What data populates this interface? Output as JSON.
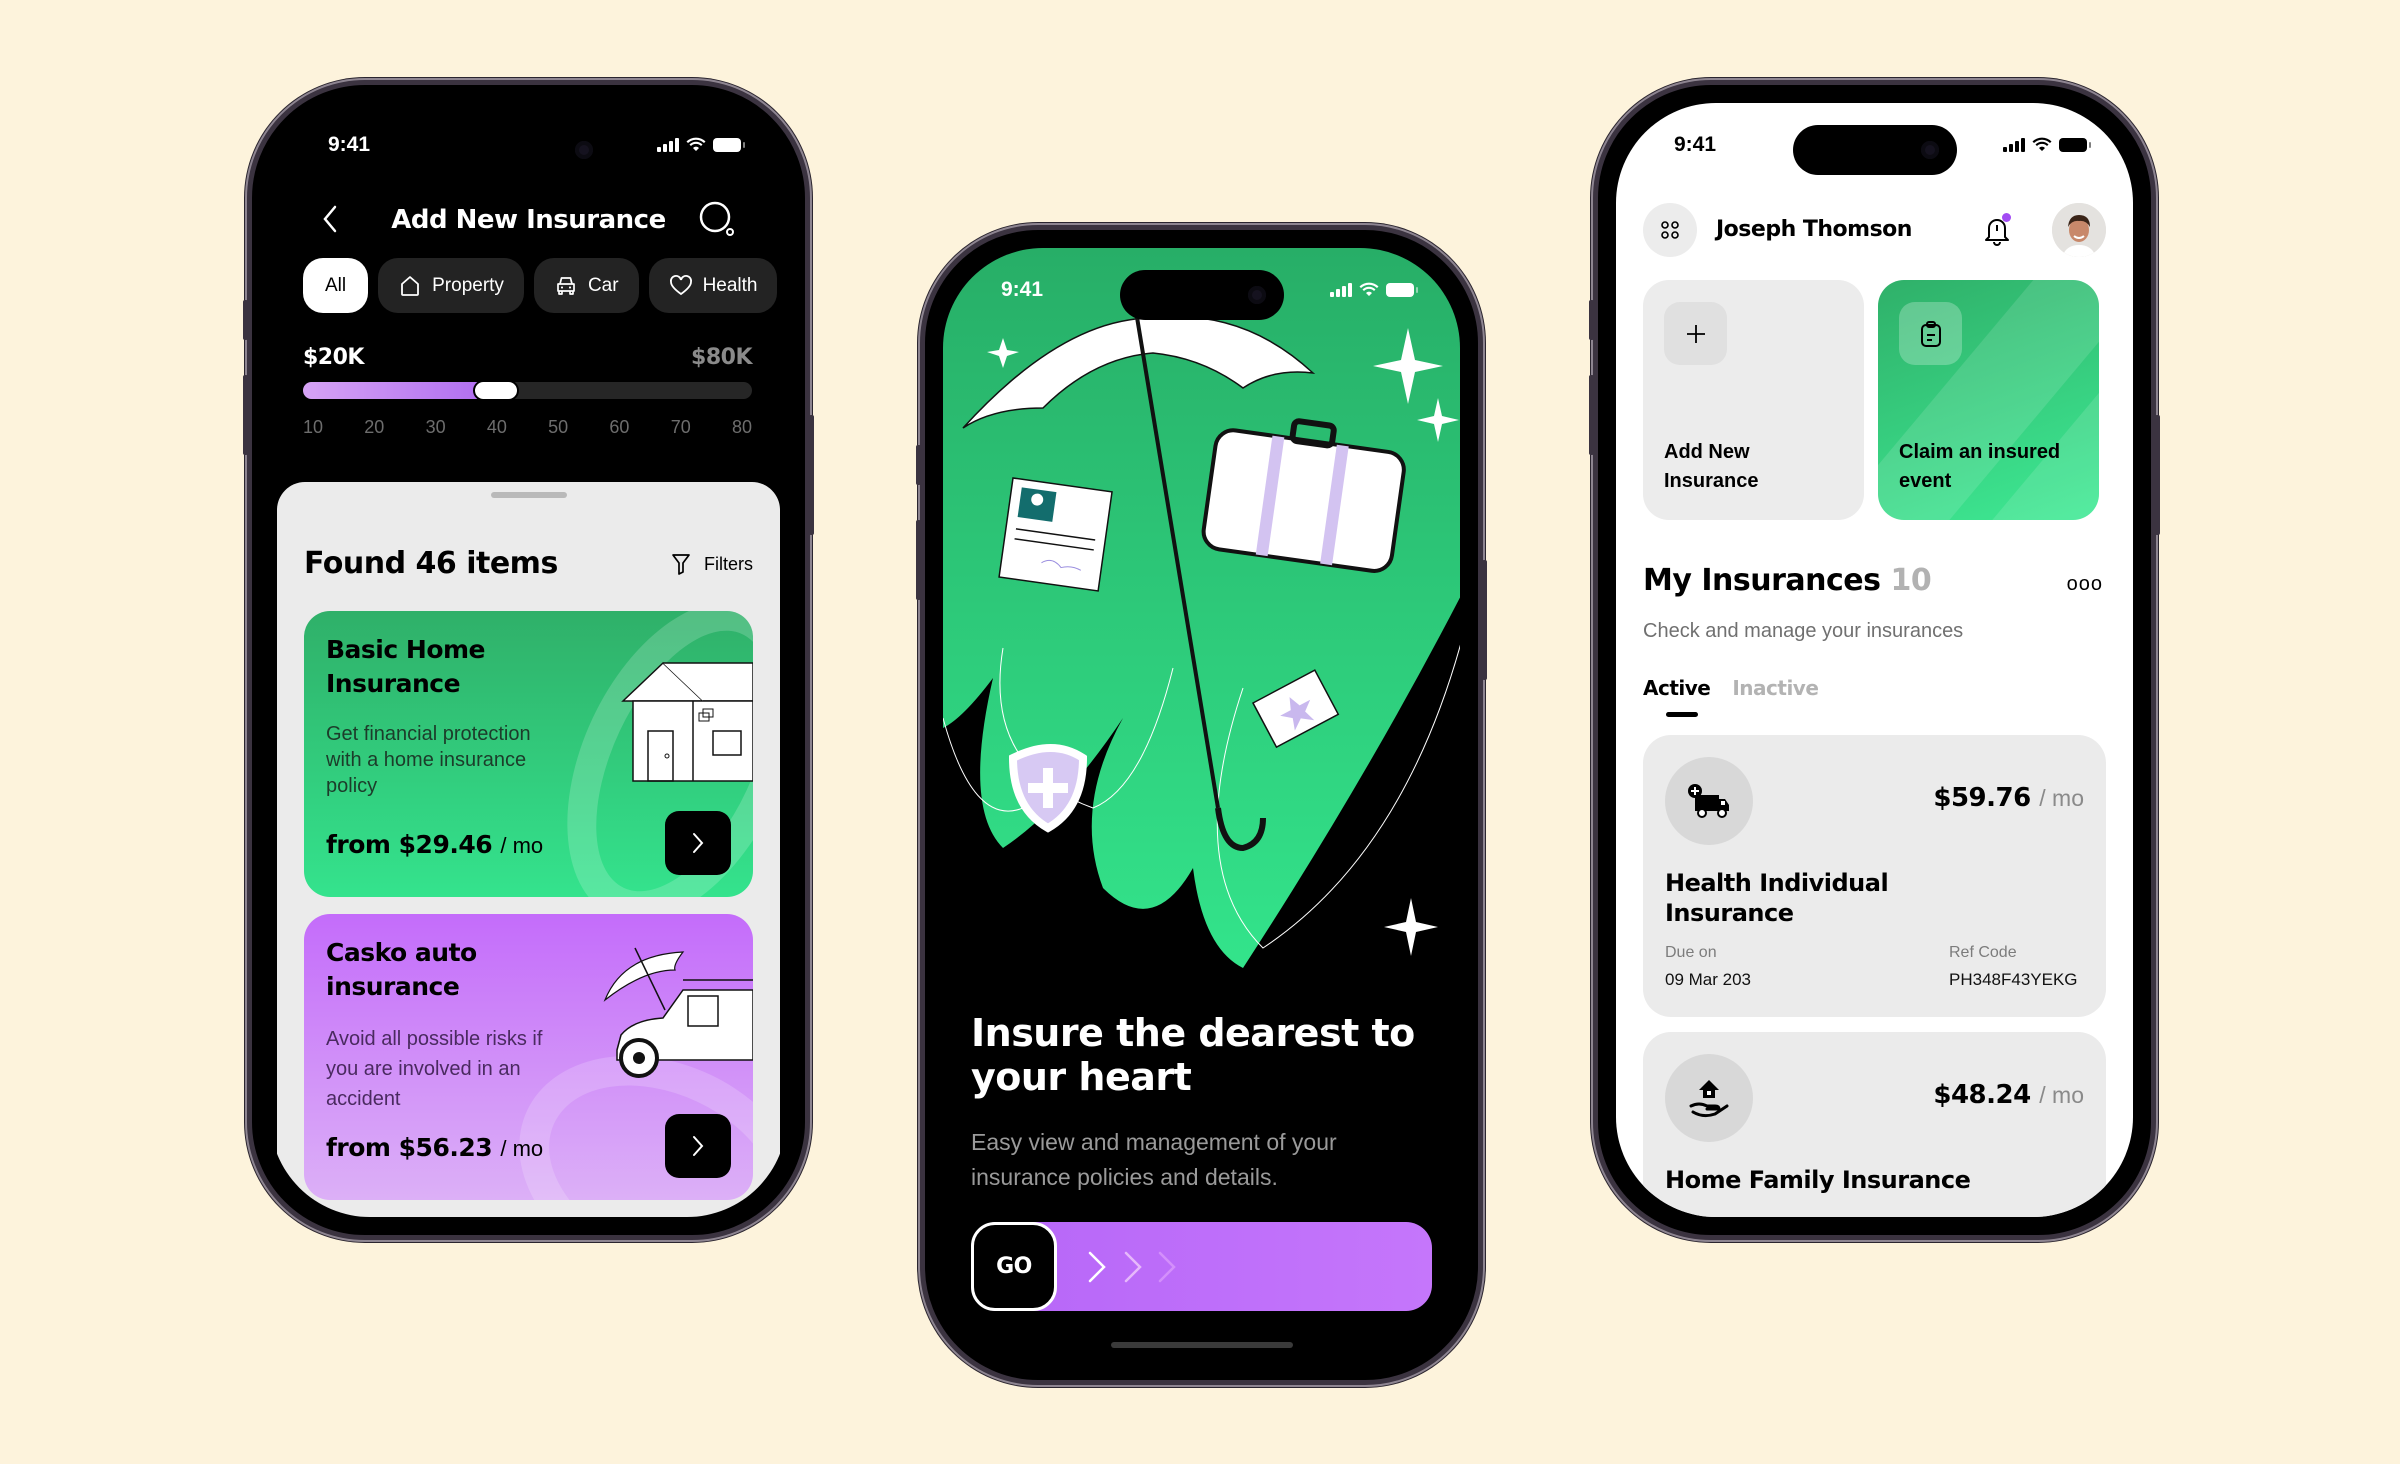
{
  "colors": {
    "background": "#fdf3dc",
    "green": "#2fd07e",
    "purple": "#b666f8",
    "notification_dot": "#a24bf3"
  },
  "phones": {
    "search": {
      "status": {
        "time": "9:41"
      },
      "header": {
        "title": "Add New Insurance",
        "back_icon": "chevron-left-icon",
        "search_icon": "search-icon"
      },
      "chips": [
        {
          "label": "All",
          "icon": null,
          "active": true
        },
        {
          "label": "Property",
          "icon": "house-icon",
          "active": false
        },
        {
          "label": "Car",
          "icon": "car-icon",
          "active": false
        },
        {
          "label": "Health",
          "icon": "heart-icon",
          "active": false
        }
      ],
      "range": {
        "min_label": "$20K",
        "max_label": "$80K",
        "ticks": [
          "10",
          "20",
          "30",
          "40",
          "50",
          "60",
          "70",
          "80"
        ],
        "axis_min": 10,
        "axis_max": 80,
        "selected_value": 37
      },
      "results": {
        "title": "Found 46 items",
        "filters_label": "Filters"
      },
      "cards": [
        {
          "title": "Basic Home Insurance",
          "description": "Get financial protection with a home insurance policy",
          "price_prefix": "from",
          "price": "$29.46",
          "period": "/ mo",
          "theme": "green"
        },
        {
          "title": "Casko auto insurance",
          "description": "Avoid all possible risks if you are involved in an accident",
          "price_prefix": "from",
          "price": "$56.23",
          "period": "/ mo",
          "theme": "purple"
        }
      ]
    },
    "onboarding": {
      "status": {
        "time": "9:41"
      },
      "headline": "Insure the dearest to your heart",
      "subtitle": "Easy view and management of your insurance policies and details.",
      "go_label": "GO"
    },
    "dashboard": {
      "status": {
        "time": "9:41"
      },
      "user_name": "Joseph Thomson",
      "has_notification": true,
      "quick_actions": [
        {
          "label": "Add New Insurance",
          "icon": "plus-icon"
        },
        {
          "label": "Claim an insured event",
          "icon": "clipboard-icon"
        }
      ],
      "section": {
        "title": "My Insurances",
        "count": "10",
        "subtitle": "Check and manage your insurances",
        "more_label": "ooo"
      },
      "tabs": [
        {
          "label": "Active",
          "active": true
        },
        {
          "label": "Inactive",
          "active": false
        }
      ],
      "policies": [
        {
          "icon": "ambulance-icon",
          "price": "$59.76",
          "period": "/ mo",
          "name": "Health Individual Insurance",
          "due_label": "Due on",
          "due_value": "09 Mar 203",
          "ref_label": "Ref Code",
          "ref_value": "PH348F43YEKG"
        },
        {
          "icon": "home-hand-icon",
          "price": "$48.24",
          "period": "/ mo",
          "name": "Home Family Insurance"
        }
      ]
    }
  }
}
